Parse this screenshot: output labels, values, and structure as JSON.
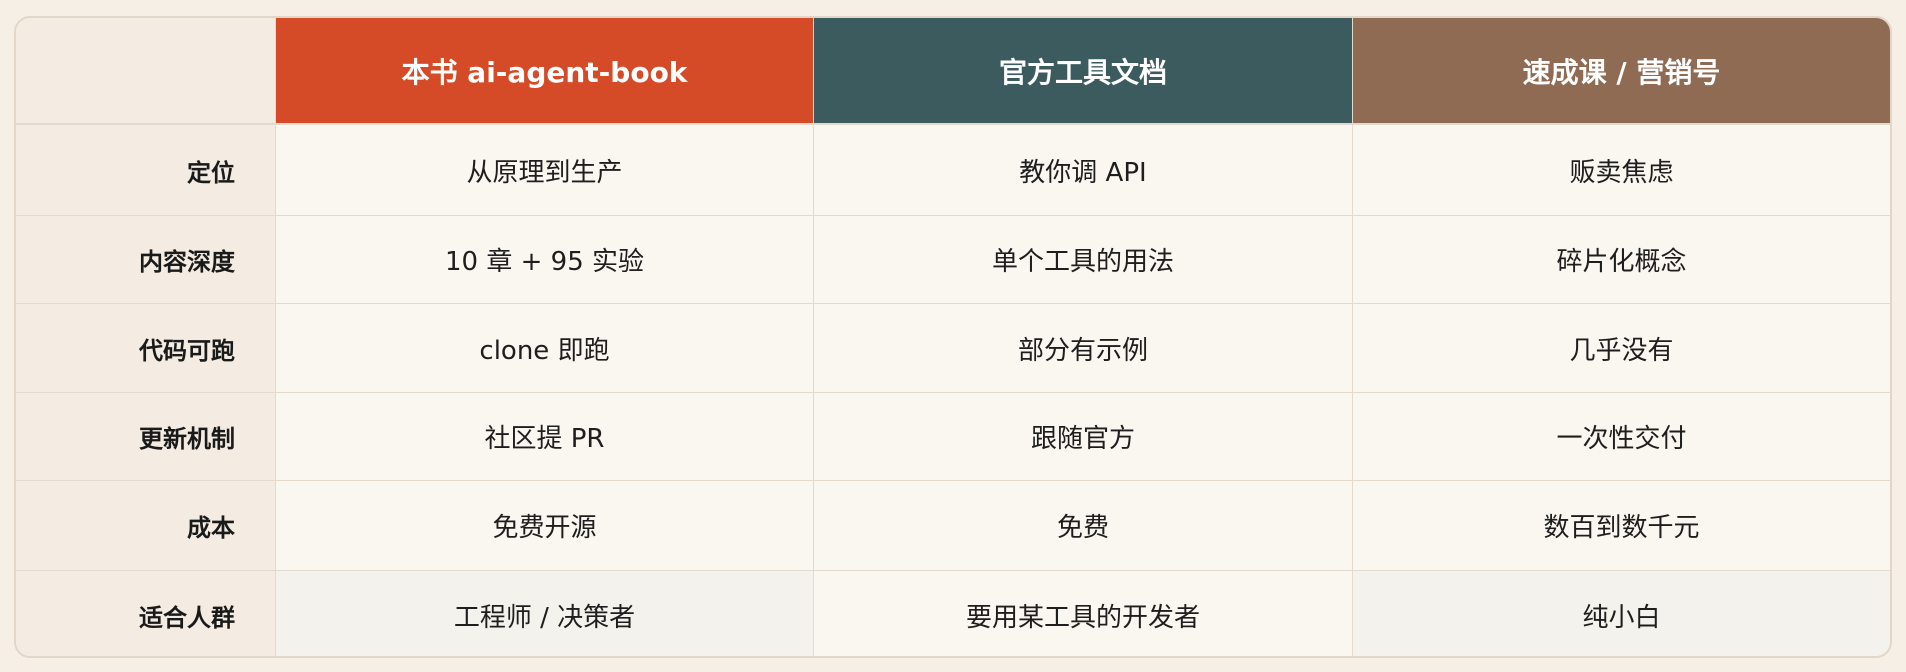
{
  "table": {
    "columns": [
      {
        "label": "本书 ai-agent-book",
        "color": "#d54b27"
      },
      {
        "label": "官方工具文档",
        "color": "#3b5b5f"
      },
      {
        "label": "速成课 / 营销号",
        "color": "#8f6b53"
      }
    ],
    "rows": [
      {
        "label": "定位",
        "cells": [
          "从原理到生产",
          "教你调 API",
          "贩卖焦虑"
        ]
      },
      {
        "label": "内容深度",
        "cells": [
          "10 章 + 95 实验",
          "单个工具的用法",
          "碎片化概念"
        ]
      },
      {
        "label": "代码可跑",
        "cells": [
          "clone 即跑",
          "部分有示例",
          "几乎没有"
        ]
      },
      {
        "label": "更新机制",
        "cells": [
          "社区提 PR",
          "跟随官方",
          "一次性交付"
        ]
      },
      {
        "label": "成本",
        "cells": [
          "免费开源",
          "免费",
          "数百到数千元"
        ]
      },
      {
        "label": "适合人群",
        "cells": [
          "工程师 / 决策者",
          "要用某工具的开发者",
          "纯小白"
        ]
      }
    ]
  }
}
